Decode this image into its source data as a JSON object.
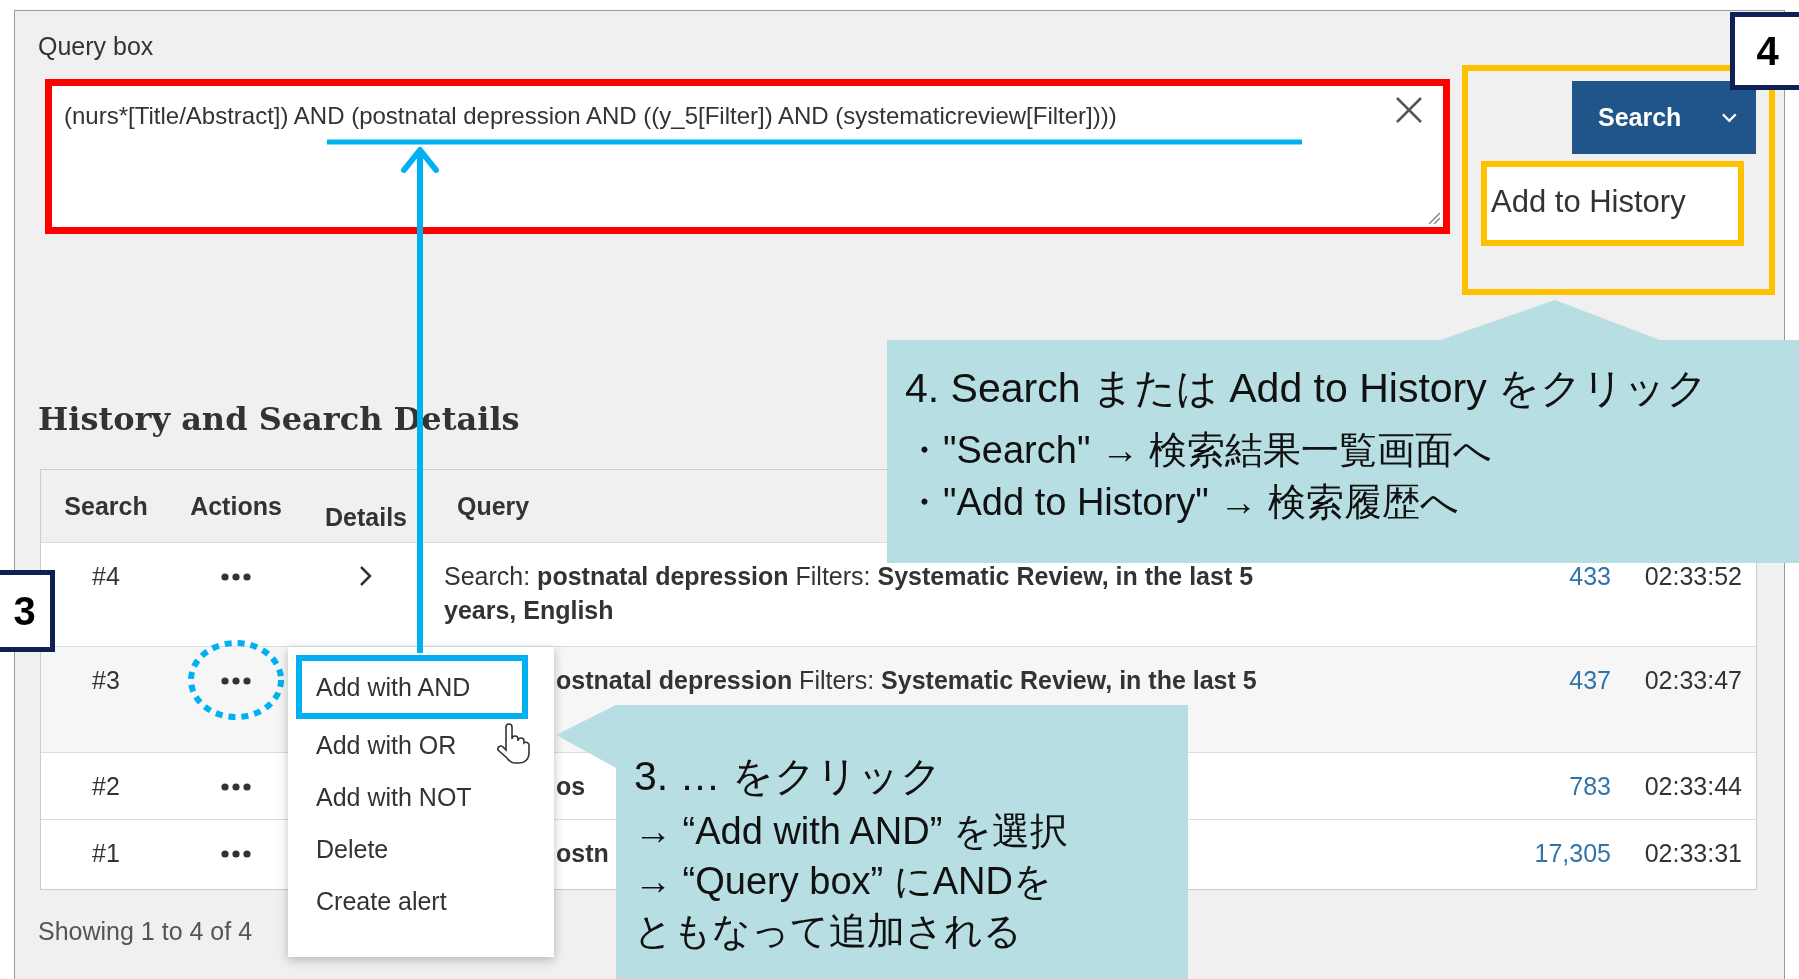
{
  "query_box": {
    "label": "Query box",
    "value": "(nurs*[Title/Abstract]) AND (postnatal depression AND ((y_5[Filter]) AND (systematicreview[Filter])))"
  },
  "search_button": {
    "label": "Search"
  },
  "search_menu": [
    {
      "label": "Add to History"
    }
  ],
  "history": {
    "title": "History and Search Details",
    "columns": [
      "Search",
      "Actions",
      "Details",
      "Query"
    ],
    "rows": [
      {
        "search": "#4",
        "query": "Search: **postnatal depression** Filters: **Systematic Review, in the last 5 years, English**",
        "results": "433",
        "time": "02:33:52",
        "menu_open": false
      },
      {
        "search": "#3",
        "query": "**ostnatal depression** Filters: **Systematic Review, in the last 5**",
        "results": "437",
        "time": "02:33:47",
        "menu_open": true
      },
      {
        "search": "#2",
        "query": "**os**",
        "results": "783",
        "time": "02:33:44",
        "menu_open": false
      },
      {
        "search": "#1",
        "query": "**ostn**",
        "results": "17,305",
        "time": "02:33:31",
        "menu_open": false
      }
    ],
    "footer": "Showing 1 to 4 of 4"
  },
  "actions_menu": [
    {
      "label": "Add with AND",
      "selected": true
    },
    {
      "label": "Add with OR",
      "selected": false
    },
    {
      "label": "Add with NOT",
      "selected": false
    },
    {
      "label": "Delete",
      "selected": false
    },
    {
      "label": "Create alert",
      "selected": false
    }
  ],
  "annotations": {
    "step_4": {
      "badge": "4",
      "title": "4. Search または Add to History をクリック",
      "lines": [
        "・\"Search\" → 検索結果一覧画面へ",
        "・\"Add to History\" → 検索履歴へ"
      ]
    },
    "step_3": {
      "badge": "3",
      "title": "3. … をクリック",
      "lines": [
        "→ “Add with AND” を選択",
        "→ “Query box” にANDを",
        "ともなって追加される"
      ]
    }
  }
}
